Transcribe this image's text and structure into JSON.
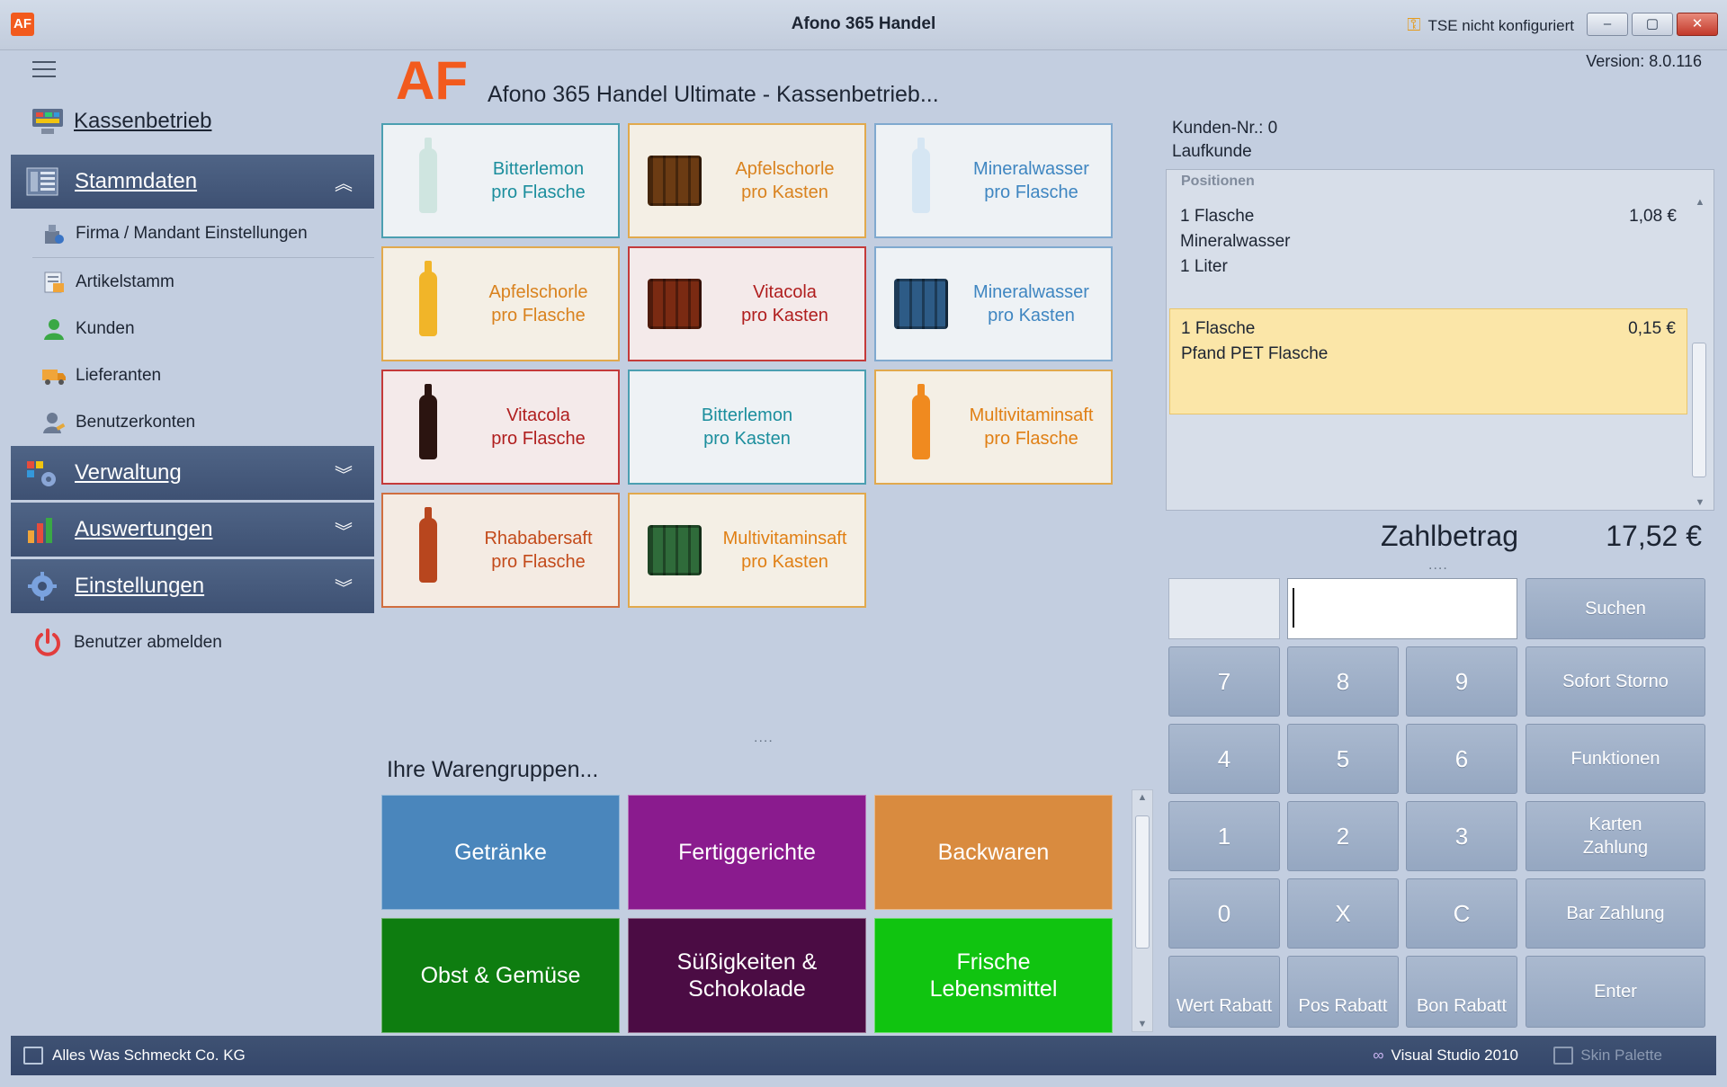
{
  "window": {
    "title": "Afono 365 Handel",
    "tse_status": "TSE nicht konfiguriert",
    "logo_text": "AF",
    "minimize_label": "–",
    "maximize_label": "▢",
    "close_label": "✕",
    "version": "Version: 8.0.116"
  },
  "header": {
    "logo_text": "AF",
    "heading": "Afono 365 Handel Ultimate - Kassenbetrieb..."
  },
  "sidebar": {
    "kassenbetrieb": "Kassenbetrieb",
    "stammdaten": {
      "label": "Stammdaten",
      "chevron": "︽"
    },
    "sub_items": [
      {
        "label": "Firma / Mandant Einstellungen",
        "icon": "company-settings-icon"
      },
      {
        "label": "Artikelstamm",
        "icon": "article-icon"
      },
      {
        "label": "Kunden",
        "icon": "customer-icon"
      },
      {
        "label": "Lieferanten",
        "icon": "truck-icon"
      },
      {
        "label": "Benutzerkonten",
        "icon": "user-accounts-icon"
      }
    ],
    "verwaltung": {
      "label": "Verwaltung",
      "chevron": "︾"
    },
    "auswertungen": {
      "label": "Auswertungen",
      "chevron": "︾"
    },
    "einstellungen": {
      "label": "Einstellungen",
      "chevron": "︾"
    },
    "logout": "Benutzer abmelden"
  },
  "products": [
    {
      "line1": "Bitterlemon",
      "line2": "pro Flasche",
      "style": "teal",
      "kind": "bottle",
      "color": "#cfe5e0"
    },
    {
      "line1": "Apfelschorle",
      "line2": "pro Kasten",
      "style": "orange",
      "kind": "crate",
      "color": "#6b3b13"
    },
    {
      "line1": "Mineralwasser",
      "line2": "pro Flasche",
      "style": "blue",
      "kind": "bottle",
      "color": "#d6e6f3"
    },
    {
      "line1": "Apfelschorle",
      "line2": "pro Flasche",
      "style": "orange",
      "kind": "bottle",
      "color": "#f1b529"
    },
    {
      "line1": "Vitacola",
      "line2": "pro Kasten",
      "style": "red",
      "kind": "crate",
      "color": "#7a2a12"
    },
    {
      "line1": "Mineralwasser",
      "line2": "pro Kasten",
      "style": "blue",
      "kind": "crate",
      "color": "#2d5b86"
    },
    {
      "line1": "Vitacola",
      "line2": "pro Flasche",
      "style": "red",
      "kind": "bottle",
      "color": "#2b1410"
    },
    {
      "line1": "Bitterlemon",
      "line2": "pro Kasten",
      "style": "teal",
      "kind": "none",
      "color": ""
    },
    {
      "line1": "Multivitaminsaft",
      "line2": "pro Flasche",
      "style": "orange2",
      "kind": "bottle",
      "color": "#f08a1f"
    },
    {
      "line1": "Rhababersaft",
      "line2": "pro Flasche",
      "style": "rhab",
      "kind": "bottle",
      "color": "#b8461e"
    },
    {
      "line1": "Multivitaminsaft",
      "line2": "pro Kasten",
      "style": "orange2",
      "kind": "crate",
      "color": "#2f6b3a"
    }
  ],
  "grip": "....",
  "groups_label": "Ihre Warengruppen...",
  "groups": [
    {
      "label": "Getränke",
      "color": "#4a86bc"
    },
    {
      "label": "Fertiggerichte",
      "color": "#8a1b8e"
    },
    {
      "label": "Backwaren",
      "color": "#d98b3f"
    },
    {
      "label": "Obst & Gemüse",
      "color": "#0e7d10"
    },
    {
      "label": "Süßigkeiten & Schokolade",
      "color": "#4b0c44"
    },
    {
      "label": "Frische Lebensmittel",
      "color": "#10c410"
    }
  ],
  "customer": {
    "number": "Kunden-Nr.: 0",
    "name": "Laufkunde"
  },
  "positions": {
    "header": "Positionen",
    "items": [
      {
        "qty": "1 Flasche",
        "name": "Mineralwasser",
        "detail": "1 Liter",
        "price": "1,08 €",
        "selected": false
      },
      {
        "qty": "1 Flasche",
        "name": "Pfand PET Flasche",
        "detail": "",
        "price": "0,15 €",
        "selected": true
      }
    ]
  },
  "payment": {
    "label": "Zahlbetrag",
    "amount": "17,52 €"
  },
  "keypad": {
    "search": "Suchen",
    "sofort_storno": "Sofort Storno",
    "funktionen": "Funktionen",
    "karten_zahlung": "Karten Zahlung",
    "bar_zahlung": "Bar Zahlung",
    "enter": "Enter",
    "digits": [
      "7",
      "8",
      "9",
      "4",
      "5",
      "6",
      "1",
      "2",
      "3",
      "0",
      "X",
      "C"
    ],
    "wert_rabatt": "Wert Rabatt",
    "pos_rabatt": "Pos Rabatt",
    "bon_rabatt": "Bon Rabatt"
  },
  "statusbar": {
    "company": "Alles Was Schmeckt  Co. KG",
    "vs": "Visual Studio 2010",
    "skin": "Skin Palette"
  }
}
